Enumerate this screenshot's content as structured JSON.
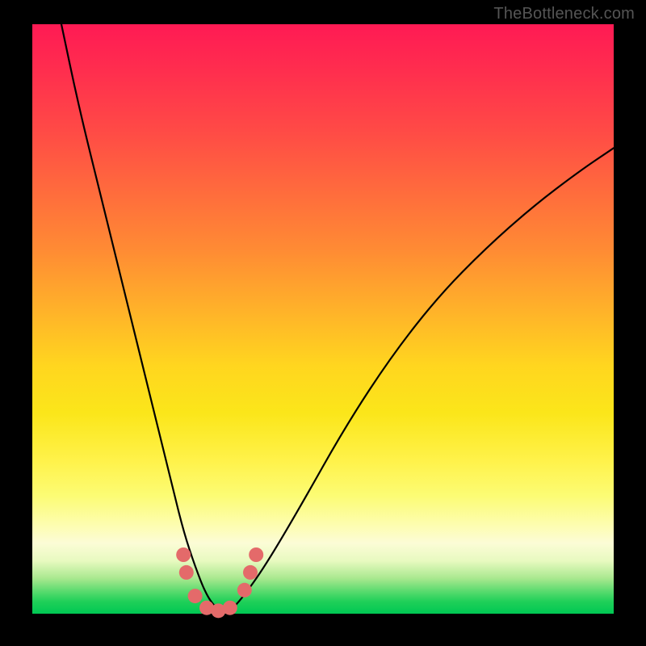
{
  "watermark": "TheBottleneck.com",
  "chart_data": {
    "type": "line",
    "title": "",
    "xlabel": "",
    "ylabel": "",
    "xlim": [
      0,
      100
    ],
    "ylim": [
      0,
      100
    ],
    "grid": false,
    "series": [
      {
        "name": "bottleneck-curve",
        "color": "#000000",
        "x": [
          5,
          8,
          12,
          16,
          20,
          24,
          26,
          28,
          30,
          32,
          34,
          36,
          40,
          46,
          54,
          62,
          70,
          78,
          86,
          94,
          100
        ],
        "y": [
          100,
          86,
          70,
          54,
          38,
          22,
          14,
          8,
          3,
          0.5,
          0.5,
          2.5,
          8,
          18,
          32,
          44,
          54,
          62,
          69,
          75,
          79
        ]
      }
    ],
    "markers": [
      {
        "name": "trough-marker",
        "color": "#e46a6a",
        "x": 26.0,
        "y": 10.0
      },
      {
        "name": "trough-marker",
        "color": "#e46a6a",
        "x": 26.5,
        "y": 7.0
      },
      {
        "name": "trough-marker",
        "color": "#e46a6a",
        "x": 28.0,
        "y": 3.0
      },
      {
        "name": "trough-marker",
        "color": "#e46a6a",
        "x": 30.0,
        "y": 1.0
      },
      {
        "name": "trough-marker",
        "color": "#e46a6a",
        "x": 32.0,
        "y": 0.5
      },
      {
        "name": "trough-marker",
        "color": "#e46a6a",
        "x": 34.0,
        "y": 1.0
      },
      {
        "name": "trough-marker",
        "color": "#e46a6a",
        "x": 36.5,
        "y": 4.0
      },
      {
        "name": "trough-marker",
        "color": "#e46a6a",
        "x": 37.5,
        "y": 7.0
      },
      {
        "name": "trough-marker",
        "color": "#e46a6a",
        "x": 38.5,
        "y": 10.0
      }
    ]
  }
}
